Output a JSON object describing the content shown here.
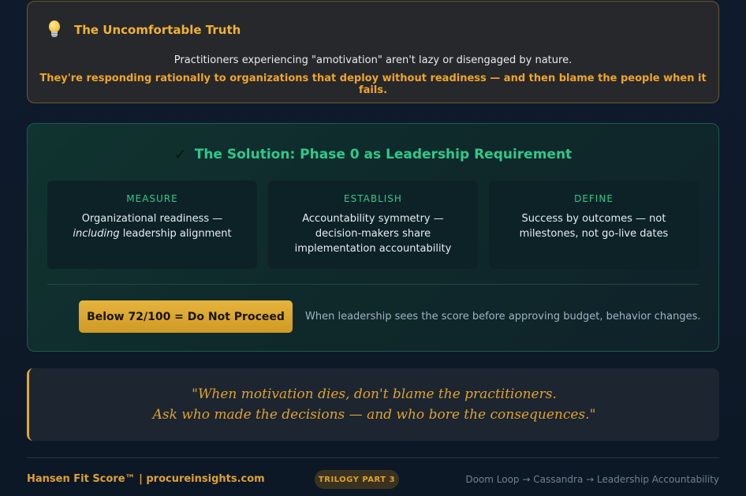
{
  "truth": {
    "title": "The Uncomfortable Truth",
    "icon": "lightbulb-icon",
    "line1": "Practitioners experiencing \"amotivation\" aren't lazy or disengaged by nature.",
    "line2": "They're responding rationally to organizations that deploy without readiness — and then blame the people when it fails."
  },
  "solution": {
    "check": "✓",
    "title": "The Solution: Phase 0 as Leadership Requirement",
    "cards": [
      {
        "label": "MEASURE",
        "text_before": "Organizational readiness — ",
        "text_em": "including",
        "text_after": " leadership alignment"
      },
      {
        "label": "ESTABLISH",
        "text": "Accountability symmetry — decision-makers share implementation accountability"
      },
      {
        "label": "DEFINE",
        "text": "Success by outcomes — not milestones, not go-live dates"
      }
    ],
    "score_badge": "Below 72/100 = Do Not Proceed",
    "score_note": "When leadership sees the score before approving budget, behavior changes."
  },
  "quote": {
    "line1": "\"When motivation dies, don't blame the practitioners.",
    "line2": "Ask who made the decisions — and who bore the consequences.\""
  },
  "footer": {
    "brand": "Hansen Fit Score™ | procureinsights.com",
    "badge": "TRILOGY PART 3",
    "series": "Doom Loop → Cassandra → Leadership Accountability"
  },
  "colors": {
    "gold": "#e0a130",
    "green": "#2ec98a",
    "background": "#0f1b2c"
  }
}
